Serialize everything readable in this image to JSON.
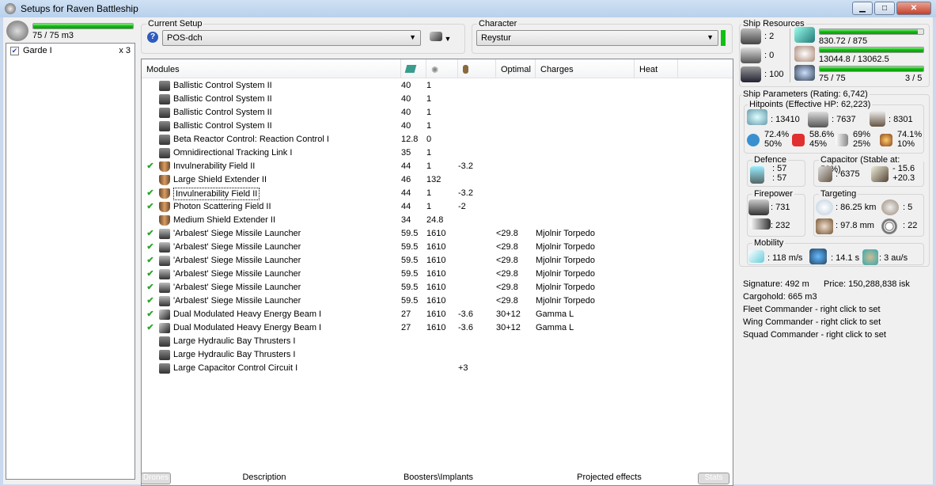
{
  "window": {
    "title": "Setups for Raven Battleship",
    "min": "▁",
    "max": "□",
    "close": "✕"
  },
  "drones": {
    "bandwidth": "75 / 75 m3",
    "bandwidth_fraction": 1.0,
    "items": [
      {
        "name": "Garde I",
        "count": "x 3",
        "checked": true
      }
    ]
  },
  "setup": {
    "label": "Current Setup",
    "value": "POS-dch",
    "help": "?"
  },
  "character": {
    "label": "Character",
    "value": "Reystur"
  },
  "table": {
    "headers": [
      "Modules",
      "",
      "",
      "",
      "Optimal",
      "Charges",
      "Heat"
    ],
    "rows": [
      {
        "check": "",
        "name": "Ballistic Control System II",
        "cpu": "40",
        "pg": "1",
        "cap": "",
        "optimal": "",
        "charges": "",
        "icon": "bcs"
      },
      {
        "check": "",
        "name": "Ballistic Control System II",
        "cpu": "40",
        "pg": "1",
        "cap": "",
        "optimal": "",
        "charges": "",
        "icon": "bcs"
      },
      {
        "check": "",
        "name": "Ballistic Control System II",
        "cpu": "40",
        "pg": "1",
        "cap": "",
        "optimal": "",
        "charges": "",
        "icon": "bcs"
      },
      {
        "check": "",
        "name": "Ballistic Control System II",
        "cpu": "40",
        "pg": "1",
        "cap": "",
        "optimal": "",
        "charges": "",
        "icon": "bcs"
      },
      {
        "check": "",
        "name": "Beta Reactor Control: Reaction Control I",
        "cpu": "12.8",
        "pg": "0",
        "cap": "",
        "optimal": "",
        "charges": "",
        "icon": "reactor"
      },
      {
        "check": "",
        "name": "Omnidirectional Tracking Link I",
        "cpu": "35",
        "pg": "1",
        "cap": "",
        "optimal": "",
        "charges": "",
        "icon": "link"
      },
      {
        "check": "✔",
        "name": "Invulnerability Field II",
        "cpu": "44",
        "pg": "1",
        "cap": "-3.2",
        "optimal": "",
        "charges": "",
        "icon": "shield"
      },
      {
        "check": "",
        "name": "Large Shield Extender II",
        "cpu": "46",
        "pg": "132",
        "cap": "",
        "optimal": "",
        "charges": "",
        "icon": "shield"
      },
      {
        "check": "✔",
        "name": "Invulnerability Field II",
        "cpu": "44",
        "pg": "1",
        "cap": "-3.2",
        "optimal": "",
        "charges": "",
        "icon": "shield",
        "selected": true
      },
      {
        "check": "✔",
        "name": "Photon Scattering Field II",
        "cpu": "44",
        "pg": "1",
        "cap": "-2",
        "optimal": "",
        "charges": "",
        "icon": "shield"
      },
      {
        "check": "",
        "name": "Medium Shield Extender II",
        "cpu": "34",
        "pg": "24.8",
        "cap": "",
        "optimal": "",
        "charges": "",
        "icon": "shield"
      },
      {
        "check": "✔",
        "name": "'Arbalest' Siege Missile Launcher",
        "cpu": "59.5",
        "pg": "1610",
        "cap": "",
        "optimal": "<29.8",
        "charges": "Mjolnir Torpedo",
        "icon": "launcher"
      },
      {
        "check": "✔",
        "name": "'Arbalest' Siege Missile Launcher",
        "cpu": "59.5",
        "pg": "1610",
        "cap": "",
        "optimal": "<29.8",
        "charges": "Mjolnir Torpedo",
        "icon": "launcher"
      },
      {
        "check": "✔",
        "name": "'Arbalest' Siege Missile Launcher",
        "cpu": "59.5",
        "pg": "1610",
        "cap": "",
        "optimal": "<29.8",
        "charges": "Mjolnir Torpedo",
        "icon": "launcher"
      },
      {
        "check": "✔",
        "name": "'Arbalest' Siege Missile Launcher",
        "cpu": "59.5",
        "pg": "1610",
        "cap": "",
        "optimal": "<29.8",
        "charges": "Mjolnir Torpedo",
        "icon": "launcher"
      },
      {
        "check": "✔",
        "name": "'Arbalest' Siege Missile Launcher",
        "cpu": "59.5",
        "pg": "1610",
        "cap": "",
        "optimal": "<29.8",
        "charges": "Mjolnir Torpedo",
        "icon": "launcher"
      },
      {
        "check": "✔",
        "name": "'Arbalest' Siege Missile Launcher",
        "cpu": "59.5",
        "pg": "1610",
        "cap": "",
        "optimal": "<29.8",
        "charges": "Mjolnir Torpedo",
        "icon": "launcher"
      },
      {
        "check": "✔",
        "name": "Dual Modulated Heavy Energy Beam I",
        "cpu": "27",
        "pg": "1610",
        "cap": "-3.6",
        "optimal": "30+12",
        "charges": "Gamma L",
        "icon": "beam"
      },
      {
        "check": "✔",
        "name": "Dual Modulated Heavy Energy Beam I",
        "cpu": "27",
        "pg": "1610",
        "cap": "-3.6",
        "optimal": "30+12",
        "charges": "Gamma L",
        "icon": "beam"
      },
      {
        "check": "",
        "name": "Large Hydraulic Bay Thrusters I",
        "cpu": "",
        "pg": "",
        "cap": "",
        "optimal": "",
        "charges": "",
        "icon": "rig"
      },
      {
        "check": "",
        "name": "Large Hydraulic Bay Thrusters I",
        "cpu": "",
        "pg": "",
        "cap": "",
        "optimal": "",
        "charges": "",
        "icon": "rig"
      },
      {
        "check": "",
        "name": "Large Capacitor Control Circuit I",
        "cpu": "",
        "pg": "",
        "cap": "+3",
        "optimal": "",
        "charges": "",
        "icon": "rig"
      }
    ]
  },
  "bottom_tabs": [
    "Drones",
    "Description",
    "Boosters\\Implants",
    "Projected effects",
    "Stats"
  ],
  "resources": {
    "label": "Ship Resources",
    "turrets": ": 2",
    "launchers": ": 0",
    "calibration": ": 100",
    "cpu": "830.72 / 875",
    "cpu_fraction": 0.949,
    "powergrid": "13044.8 / 13062.5",
    "pg_fraction": 0.999,
    "drone_bay": "75 / 75",
    "drone_fraction": 1.0,
    "drones_active": "3 / 5"
  },
  "params": {
    "label": "Ship Parameters (Rating: 6,742)",
    "hitpoints": {
      "label": "Hitpoints (Effective HP: 62,223)",
      "shield": ": 13410",
      "armor": ": 7637",
      "structure": ": 8301",
      "res": [
        {
          "a": "72.4%",
          "b": "50%"
        },
        {
          "a": "58.6%",
          "b": "45%"
        },
        {
          "a": "69%",
          "b": "25%"
        },
        {
          "a": "74.1%",
          "b": "10%"
        }
      ]
    },
    "defence": {
      "label": "Defence",
      "v1": ": 57",
      "v2": ": 57"
    },
    "capacitor": {
      "label": "Capacitor (Stable at: 58%)",
      "cap": ": 6375",
      "delta1": "- 15.6",
      "delta2": "+20.3"
    },
    "firepower": {
      "label": "Firepower",
      "dps": ": 731",
      "volley": ": 232"
    },
    "targeting": {
      "label": "Targeting",
      "range": ": 86.25 km",
      "targets": ": 5",
      "scan": ": 97.8 mm",
      "sensor": ": 22"
    },
    "mobility": {
      "label": "Mobility",
      "speed": ": 118 m/s",
      "align": ": 14.1 s",
      "warp": ": 3 au/s"
    },
    "signature": "Signature: 492 m",
    "price": "Price: 150,288,838 isk",
    "cargo": "Cargohold: 665 m3",
    "fleet": "Fleet Commander - right click to set",
    "wing": "Wing Commander - right click to set",
    "squad": "Squad Commander - right click to set"
  }
}
